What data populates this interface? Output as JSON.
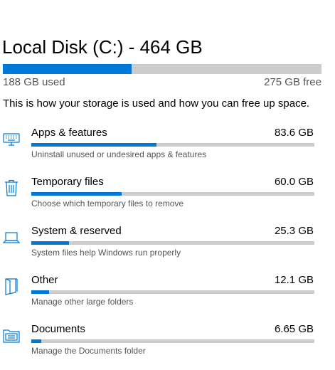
{
  "drive": {
    "title": "Local Disk (C:) - 464 GB",
    "used_label": "188 GB used",
    "free_label": "275 GB free",
    "used_fraction": 0.405
  },
  "intro_text": "This is how your storage is used and how you can free up space.",
  "categories": [
    {
      "name": "Apps & features",
      "size": "83.6 GB",
      "description": "Uninstall unused or undesired apps & features",
      "fraction": 0.443,
      "icon": "monitor-keyboard-icon"
    },
    {
      "name": "Temporary files",
      "size": "60.0 GB",
      "description": "Choose which temporary files to remove",
      "fraction": 0.318,
      "icon": "trash-icon"
    },
    {
      "name": "System & reserved",
      "size": "25.3 GB",
      "description": "System files help Windows run properly",
      "fraction": 0.134,
      "icon": "laptop-icon"
    },
    {
      "name": "Other",
      "size": "12.1 GB",
      "description": "Manage other large folders",
      "fraction": 0.064,
      "icon": "folder-page-icon"
    },
    {
      "name": "Documents",
      "size": "6.65 GB",
      "description": "Manage the Documents folder",
      "fraction": 0.035,
      "icon": "documents-folder-icon"
    }
  ],
  "colors": {
    "accent": "#0078d7",
    "bar_track": "#cccccc",
    "secondary_text": "#555555"
  }
}
